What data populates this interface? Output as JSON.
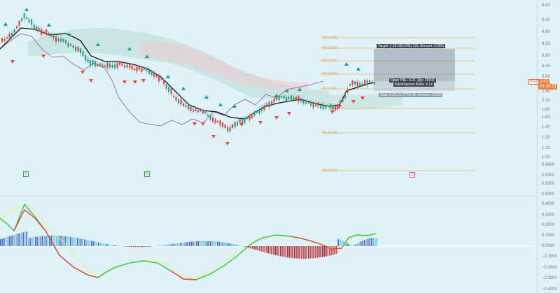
{
  "price_axis": {
    "ticks": [
      "6.00",
      "5.40",
      "4.80",
      "4.20",
      "3.80",
      "3.40",
      "3.00",
      "2.70",
      "2.40",
      "2.10",
      "1.80",
      "1.60",
      "1.40",
      "1.25",
      "1.10",
      "1.00",
      "0.9800",
      "0.9000",
      "0.8000",
      "0.6000"
    ],
    "last_price": "2.43",
    "countdown": "04:36:29",
    "symbol_tag": "HIVE"
  },
  "macd_axis": {
    "ticks": [
      "0.4000",
      "0.3000",
      "0.2000",
      "0.1000",
      "0.0000",
      "−0.1000",
      "−0.2000",
      "−0.3000",
      "−0.4000"
    ]
  },
  "levels": {
    "r5": "R5 (4.58)",
    "r4": "R4 (3.65)",
    "r3": "R3 (3.12)",
    "r2": "R2 (2.64)",
    "r1": "R1 (2.22)",
    "s1": "S1 (1.43)",
    "s2": "S2 (0.84)"
  },
  "position": {
    "target": "Target: 1.16 (48.33%) 116, Amount: 57000",
    "open_pl": "Open P&L: 0.02, Qty: 25000",
    "risk_reward": "Risk/Reward Ratio: 4.14",
    "stop": "Stop: 0.28 (11.67%) 28, Amount: 31000"
  },
  "markers": {
    "e1": "E",
    "e2": "E",
    "d1": "D"
  },
  "colors": {
    "up": "#2e9e8f",
    "down": "#e0483c",
    "signal_up": "#169e8a",
    "signal_down": "#e8473a",
    "cloud": "#b8ddd0",
    "cloud_red": "#f0c8d2",
    "level": "#e8c27a",
    "price_tag": "#f07f38",
    "lagging": "#8a5a9e",
    "macd_fast": "#35c447",
    "macd_slow": "#f2e78a"
  }
}
